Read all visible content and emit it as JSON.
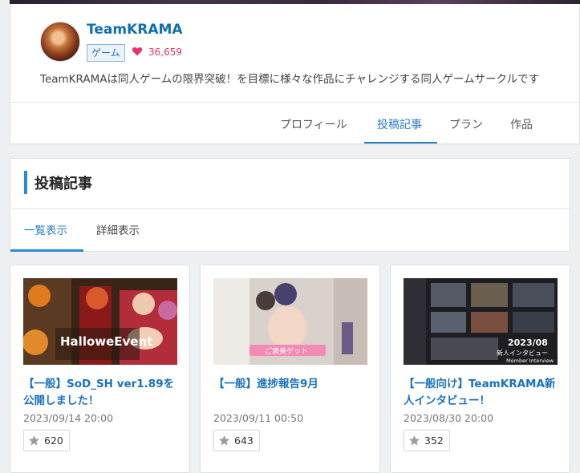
{
  "profile": {
    "name": "TeamKRAMA",
    "genre": "ゲーム",
    "favorites": "36,659",
    "description": "TeamKRAMAは同人ゲームの限界突破！を目標に様々な作品にチャレンジする同人ゲームサークルです"
  },
  "profile_tabs": [
    {
      "label": "プロフィール"
    },
    {
      "label": "投稿記事"
    },
    {
      "label": "プラン"
    },
    {
      "label": "作品"
    }
  ],
  "posts_section": {
    "heading": "投稿記事",
    "view_tabs": [
      {
        "label": "一覧表示"
      },
      {
        "label": "詳細表示"
      }
    ]
  },
  "posts": [
    {
      "title": "【一般】SoD_SH ver1.89を公開しました！",
      "date": "2023/09/14 20:00",
      "likes": "620",
      "thumb_text": "HalloweEvent"
    },
    {
      "title": "【一般】進捗報告9月",
      "date": "2023/09/11 00:50",
      "likes": "643",
      "thumb_text": "ご褒美ゲット"
    },
    {
      "title": "【一般向け】TeamKRAMA新人インタビュー！",
      "date": "2023/08/30 20:00",
      "likes": "352",
      "thumb_text_1": "2023/08",
      "thumb_text_2": "新人インタビュー",
      "thumb_text_3": "Member Interview"
    }
  ],
  "colors": {
    "accent": "#2a7ec4",
    "link": "#1a72bd",
    "heart": "#e2356a"
  }
}
